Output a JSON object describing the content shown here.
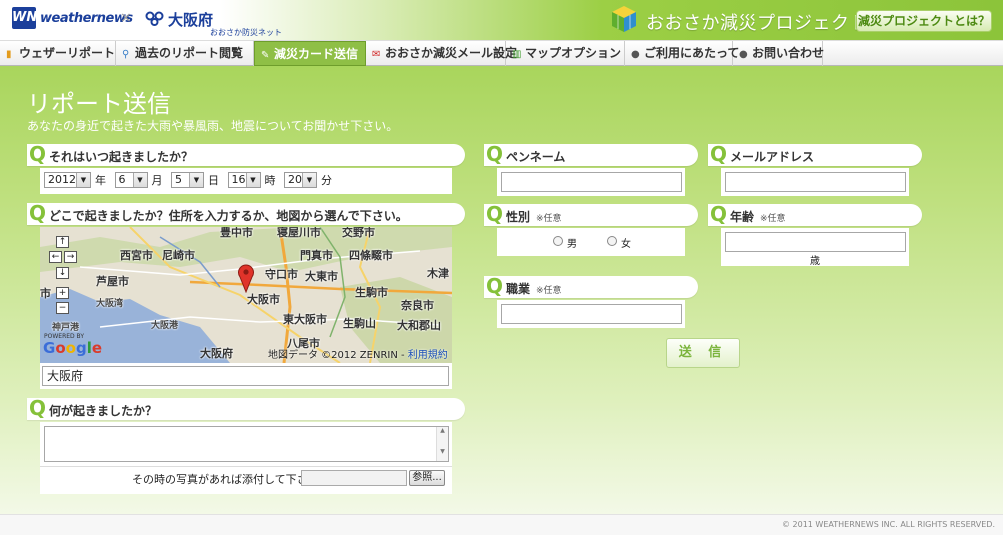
{
  "header": {
    "wn_logo": "WN",
    "wn_text": "weathernews",
    "cross": "×",
    "osaka_name": "大阪府",
    "osaka_sub": "おおさか防災ネット",
    "project_title": "おおさか減災プロジェクト",
    "project_button": "減災プロジェクトとは？"
  },
  "nav": [
    {
      "label": "ウェザーリポート",
      "icon": "document-icon"
    },
    {
      "label": "過去のリポート閲覧",
      "icon": "search-icon"
    },
    {
      "label": "減災カード送信",
      "icon": "pencil-icon"
    },
    {
      "label": "おおさか減災メール設定",
      "icon": "mail-icon"
    },
    {
      "label": "マップオプション",
      "icon": "chart-icon"
    },
    {
      "label": "ご利用にあたって",
      "icon": "bullet-icon"
    },
    {
      "label": "お問い合わせ",
      "icon": "bullet-icon"
    }
  ],
  "main": {
    "title": "リポート送信",
    "subtitle": "あなたの身近で起きた大雨や暴風雨、地震についてお聞かせ下さい。",
    "q_mark": "Q",
    "q_when": "それはいつ起きましたか？",
    "q_where": "どこで起きましたか？住所を入力するか、地図から選んで下さい。",
    "q_what": "何が起きましたか？",
    "q_penname": "ペンネーム",
    "q_email": "メールアドレス",
    "q_gender": "性別",
    "q_age": "年齢",
    "q_job": "職業",
    "optional": "※任意",
    "date": {
      "year": "2012",
      "year_unit": "年",
      "month": "6",
      "month_unit": "月",
      "day": "5",
      "day_unit": "日",
      "hour": "16",
      "hour_unit": "時",
      "minute": "20",
      "minute_unit": "分"
    },
    "address_value": "大阪府",
    "photo_label": "その時の写真があれば添付して下さい。",
    "browse_button": "参照...",
    "gender_male": "男",
    "gender_female": "女",
    "age_unit": "歳",
    "send_button": "送 信"
  },
  "map": {
    "labels": [
      "豊中市",
      "寝屋川市",
      "交野市",
      "西宮市",
      "尼崎市",
      "門真市",
      "四條畷市",
      "守口市",
      "大東市",
      "木津",
      "芦屋市",
      "大阪市",
      "生駒市",
      "大阪湾",
      "奈良市",
      "東大阪市",
      "神戸港",
      "大阪港",
      "生駒山",
      "大和郡山",
      "八尾市",
      "大阪府",
      "市"
    ],
    "powered_by": "POWERED BY",
    "google": "Google",
    "copyright": "地図データ ©2012 ZENRIN - ",
    "terms_link": "利用規約",
    "controls": {
      "up": "↑",
      "left": "←",
      "right": "→",
      "down": "↓",
      "zoom_in": "+",
      "zoom_out": "−"
    }
  },
  "footer": {
    "copyright": "© 2011 WEATHERNEWS INC. ALL RIGHTS RESERVED."
  },
  "colors": {
    "accent_green": "#85c13a",
    "brand_blue": "#1b3f9b",
    "nav_active": "#8fbf46"
  }
}
